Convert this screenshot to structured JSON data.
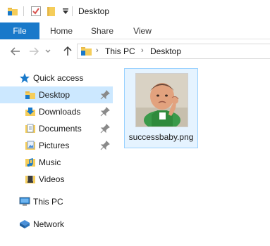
{
  "window": {
    "title": "Desktop"
  },
  "ribbon": {
    "tabs": [
      {
        "label": "File"
      },
      {
        "label": "Home"
      },
      {
        "label": "Share"
      },
      {
        "label": "View"
      }
    ]
  },
  "address": {
    "crumbs": [
      "This PC",
      "Desktop"
    ]
  },
  "sidebar": {
    "quick_access": "Quick access",
    "items": [
      {
        "label": "Desktop",
        "icon": "desktop-folder-icon",
        "pinned": true
      },
      {
        "label": "Downloads",
        "icon": "downloads-folder-icon",
        "pinned": true
      },
      {
        "label": "Documents",
        "icon": "documents-folder-icon",
        "pinned": true
      },
      {
        "label": "Pictures",
        "icon": "pictures-folder-icon",
        "pinned": true
      },
      {
        "label": "Music",
        "icon": "music-folder-icon",
        "pinned": false
      },
      {
        "label": "Videos",
        "icon": "videos-folder-icon",
        "pinned": false
      }
    ],
    "this_pc": "This PC",
    "network": "Network"
  },
  "files": [
    {
      "name": "successbaby.png",
      "selected": true
    }
  ],
  "colors": {
    "accent": "#1979ca",
    "selection": "#cce8ff",
    "tile_selection": "#e5f3ff",
    "folder": "#f2c94c"
  }
}
